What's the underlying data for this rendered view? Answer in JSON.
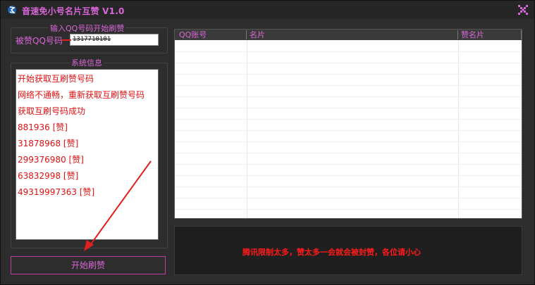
{
  "window": {
    "title": "音速免小号名片互赞 V1.0",
    "icons": {
      "app": "app-logo-icon",
      "close": "close-icon"
    }
  },
  "input_group": {
    "legend": "输入QQ号码开始刷赞",
    "label": "被赞QQ号码",
    "qq_value": "1317710101"
  },
  "system_info": {
    "legend": "系统信息",
    "lines": [
      "开始获取互刷赞号码",
      "网络不通畅，重新获取互刷赞号码",
      "获取互刷号码成功",
      "881936 [赞]",
      "31878968 [赞]",
      "299376980 [赞]",
      "63832998 [赞]",
      "49319997363 [赞]"
    ]
  },
  "start_button": {
    "label": "开始刷赞"
  },
  "table": {
    "columns": [
      "QQ账号",
      "名片",
      "赞名片"
    ],
    "rows": []
  },
  "notice": {
    "text": "腾讯限制太多，赞太多一会就会被封赞，各位请小心"
  },
  "colors": {
    "accent": "#d966d9",
    "log_text": "#e01010",
    "notice_text": "#ff1a1a",
    "arrow": "#e02020",
    "background": "#2d2d2d"
  }
}
